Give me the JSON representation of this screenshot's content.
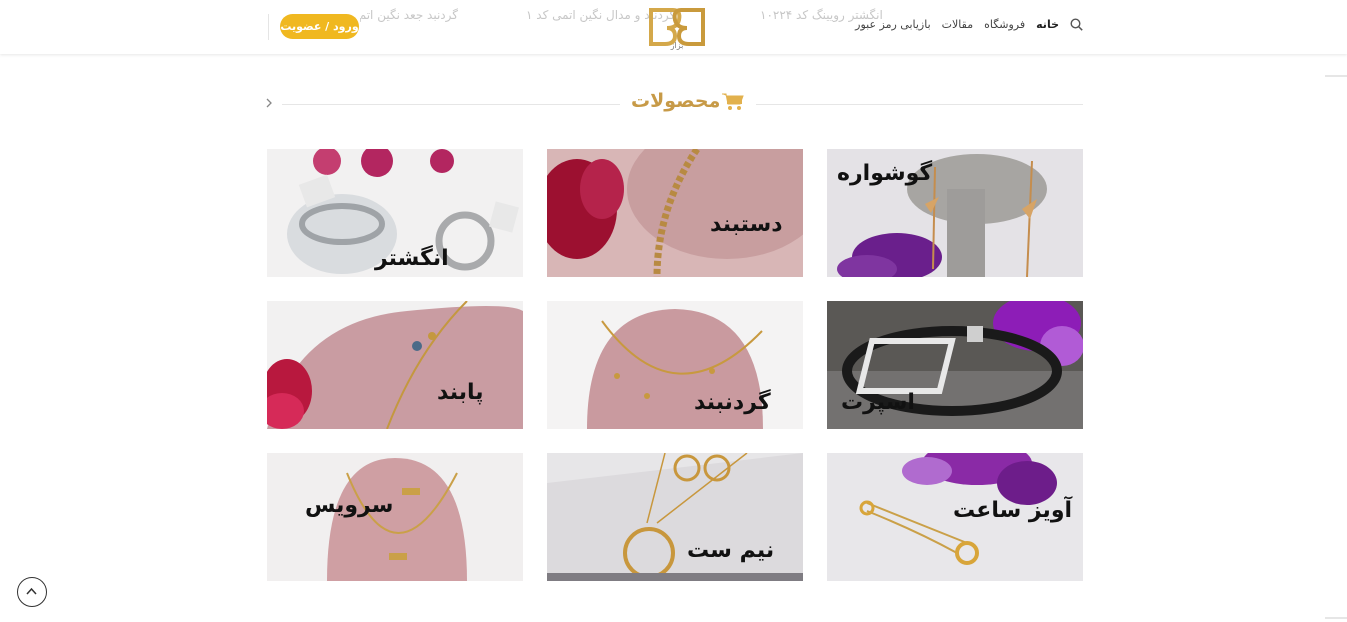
{
  "header": {
    "nav": [
      "خانه",
      "فروشگاه",
      "مقالات",
      "بازیابی رمز عبور"
    ],
    "faded_texts": [
      "انگشتر رویینگ کد ۱۰۲۲۴",
      "گردنبد و مدال نگین اتمی کد ۱",
      "گردنبد جعد نگین اتم"
    ],
    "logo_text": "بزاز",
    "login_label": "ورود / عضویت",
    "accent_color": "#f0b820"
  },
  "section": {
    "title": "محصولات",
    "title_color": "#c79a47",
    "icon": "cart-icon"
  },
  "products": [
    {
      "label": "گوشواره"
    },
    {
      "label": "دستبند"
    },
    {
      "label": "انگشتر"
    },
    {
      "label": "اسپرت"
    },
    {
      "label": "گردنبند"
    },
    {
      "label": "پابند"
    },
    {
      "label": "آویز ساعت"
    },
    {
      "label": "نیم ست"
    },
    {
      "label": "سرویس"
    }
  ]
}
